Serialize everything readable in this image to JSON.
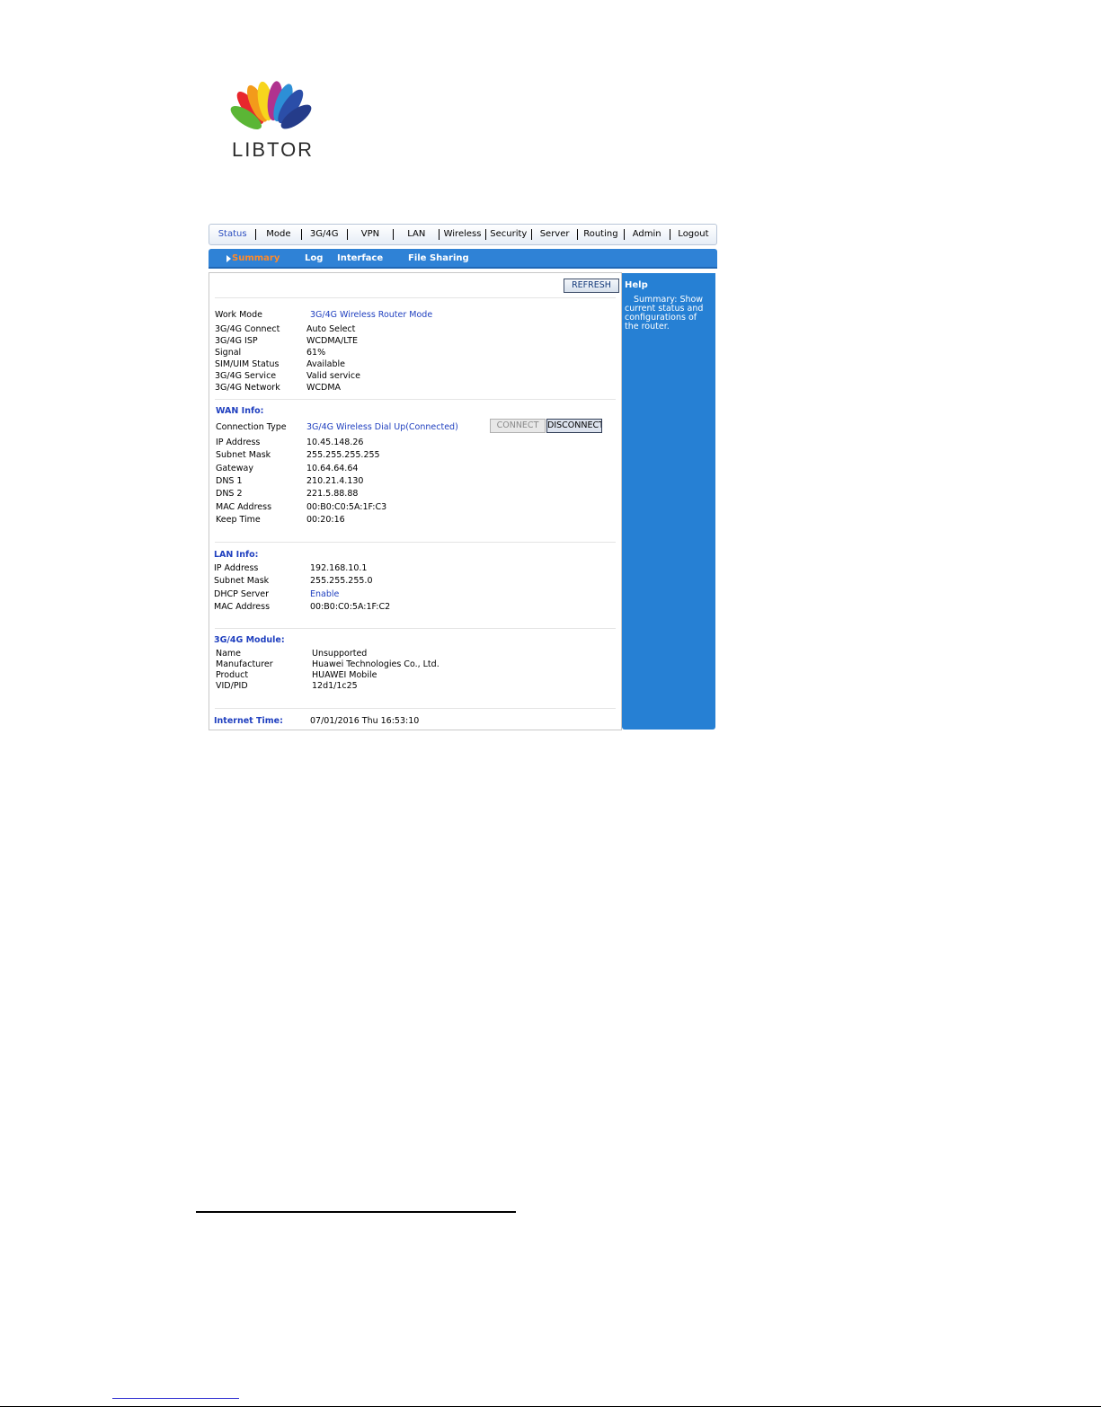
{
  "logo": {
    "text": "LIBTOR"
  },
  "nav": {
    "items": [
      "Status",
      "Mode",
      "3G/4G",
      "VPN",
      "LAN",
      "Wireless",
      "Security",
      "Server",
      "Routing",
      "Admin",
      "Logout"
    ],
    "active": "Status"
  },
  "subnav": {
    "items": [
      "Summary",
      "Log",
      "Interface",
      "File Sharing"
    ],
    "active": "Summary"
  },
  "refresh_label": "REFRESH",
  "status": {
    "work_mode": {
      "label": "Work Mode",
      "value": "3G/4G Wireless Router Mode"
    },
    "rows": [
      {
        "label": "3G/4G Connect",
        "value": "Auto Select"
      },
      {
        "label": "3G/4G ISP",
        "value": "WCDMA/LTE"
      },
      {
        "label": "Signal",
        "value": "61%"
      },
      {
        "label": "SIM/UIM Status",
        "value": "Available"
      },
      {
        "label": "3G/4G Service",
        "value": "Valid service"
      },
      {
        "label": "3G/4G Network",
        "value": "WCDMA"
      }
    ]
  },
  "wan": {
    "title": "WAN Info:",
    "connection": {
      "label": "Connection Type",
      "value": "3G/4G Wireless Dial Up(Connected)"
    },
    "connect_label": "CONNECT",
    "disconnect_label": "DISCONNECT",
    "rows": [
      {
        "label": "IP Address",
        "value": "10.45.148.26"
      },
      {
        "label": "Subnet Mask",
        "value": "255.255.255.255"
      },
      {
        "label": "Gateway",
        "value": "10.64.64.64"
      },
      {
        "label": "DNS 1",
        "value": "210.21.4.130"
      },
      {
        "label": "DNS 2",
        "value": "221.5.88.88"
      },
      {
        "label": "MAC Address",
        "value": "00:B0:C0:5A:1F:C3"
      },
      {
        "label": "Keep Time",
        "value": "00:20:16"
      }
    ]
  },
  "lan": {
    "title": "LAN Info:",
    "rows": [
      {
        "label": "IP Address",
        "value": "192.168.10.1"
      },
      {
        "label": "Subnet Mask",
        "value": "255.255.255.0"
      },
      {
        "label": "DHCP Server",
        "value": "Enable"
      },
      {
        "label": "MAC Address",
        "value": "00:B0:C0:5A:1F:C2"
      }
    ]
  },
  "module": {
    "title": "3G/4G Module:",
    "rows": [
      {
        "label": "Name",
        "value": "Unsupported"
      },
      {
        "label": "Manufacturer",
        "value": "Huawei Technologies Co., Ltd."
      },
      {
        "label": "Product",
        "value": "HUAWEI Mobile"
      },
      {
        "label": "VID/PID",
        "value": "12d1/1c25"
      }
    ]
  },
  "internet_time": {
    "label": "Internet Time:",
    "value": "07/01/2016 Thu 16:53:10"
  },
  "help": {
    "title": "Help",
    "text": "Summary: Show current status and configurations of the router."
  },
  "colors": {
    "accent_blue": "#2680d4",
    "link_blue": "#1f3fbf",
    "active_orange": "#ff8a2a"
  }
}
